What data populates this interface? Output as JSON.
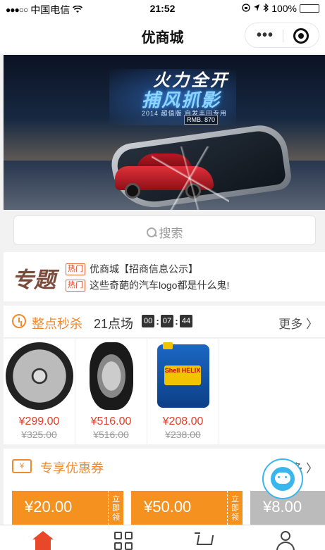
{
  "status_bar": {
    "signal": "●●●○○",
    "carrier": "中国电信",
    "time": "21:52",
    "battery": "100%"
  },
  "nav": {
    "title": "优商城",
    "more_glyph": "•••"
  },
  "banner": {
    "headline_1": "火力全开",
    "headline_2": "捕风抓影",
    "subline": "2014 超值版 自发丰田专用",
    "price_tag": "RMB. 870"
  },
  "search": {
    "placeholder": "搜索"
  },
  "topics": {
    "label": "专题",
    "items": [
      {
        "badge": "热门",
        "text": "优商城【招商信息公示】"
      },
      {
        "badge": "热门",
        "text": "这些奇葩的汽车logo都是什么鬼!"
      }
    ]
  },
  "seckill": {
    "title": "整点秒杀",
    "session": "21点场",
    "countdown": {
      "h": "00",
      "m": "07",
      "s": "44"
    },
    "more": "更多 〉",
    "products": [
      {
        "icon": "wheel-rim",
        "price": "¥299.00",
        "old_price": "¥325.00"
      },
      {
        "icon": "tire",
        "price": "¥516.00",
        "old_price": "¥516.00"
      },
      {
        "icon": "engine-oil",
        "price": "¥208.00",
        "old_price": "¥238.00",
        "oil_label": "Shell HELIX"
      }
    ]
  },
  "coupons": {
    "icon_text": "¥",
    "title": "专享优惠券",
    "more": "多 〉",
    "items": [
      {
        "value": "¥20.00",
        "stub": "立即领"
      },
      {
        "value": "¥50.00",
        "stub": "立即领"
      },
      {
        "value": "¥8.00",
        "stub": ""
      }
    ]
  },
  "tabbar": {
    "items": [
      "home",
      "category",
      "cart",
      "me"
    ],
    "active_color": "#e8472a"
  }
}
